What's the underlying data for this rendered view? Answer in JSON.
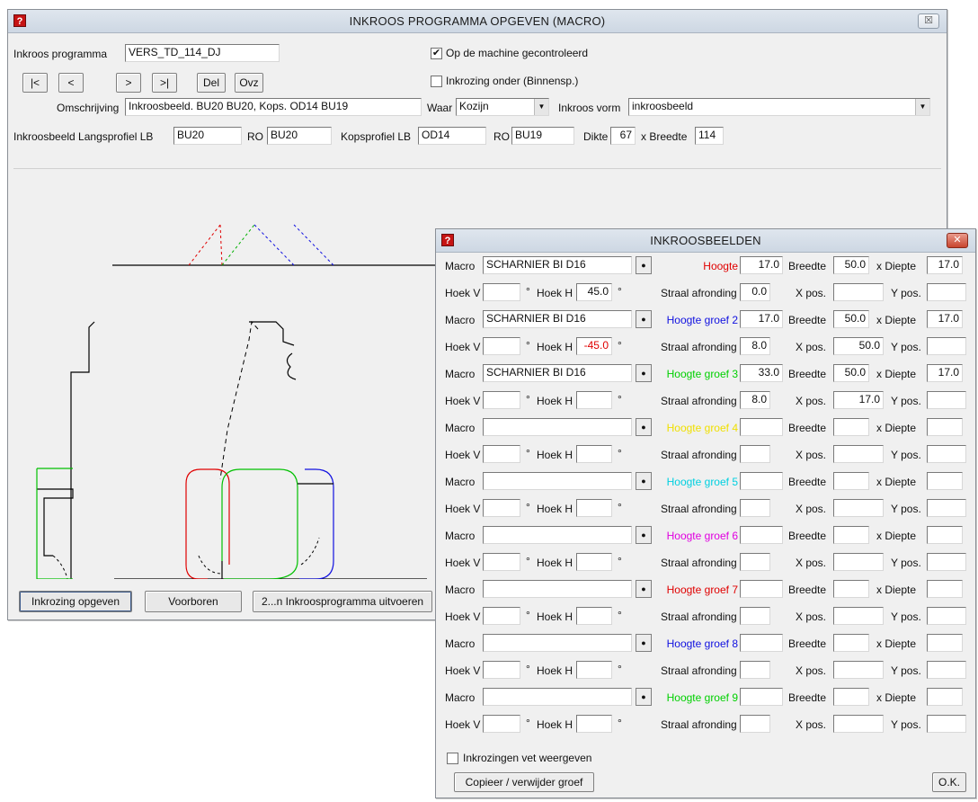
{
  "main_window": {
    "title": "INKROOS PROGRAMMA OPGEVEN (MACRO)",
    "close_glyph": "☒",
    "program_label": "Inkroos programma",
    "program_value": "VERS_TD_114_DJ",
    "nav": {
      "first": "|<",
      "prev": "<",
      "next": ">",
      "last": ">|",
      "del": "Del",
      "ovz": "Ovz"
    },
    "checked_on_machine": {
      "label": "Op de machine gecontroleerd",
      "checked": true,
      "glyph": "✔"
    },
    "inkrozing_onder": {
      "label": "Inkrozing onder (Binnensp.)",
      "checked": false
    },
    "omschrijving_label": "Omschrijving",
    "omschrijving_value": "Inkroosbeeld. BU20 BU20, Kops. OD14 BU19",
    "waar_label": "Waar",
    "waar_value": "Kozijn",
    "vorm_label": "Inkroos vorm",
    "vorm_value": "inkroosbeeld",
    "langsprofiel_label": "Inkroosbeeld Langsprofiel LB",
    "langsprofiel_lb": "BU20",
    "ro_label": "RO",
    "langsprofiel_ro": "BU20",
    "kopsprofiel_label": "Kopsprofiel LB",
    "kopsprofiel_lb": "OD14",
    "kopsprofiel_ro": "BU19",
    "dikte_label": "Dikte",
    "dikte_value": "67",
    "breedte_label": "x Breedte",
    "breedte_value": "114",
    "buttons": {
      "inkrozing": "Inkrozing opgeven",
      "voorboren": "Voorboren",
      "uitvoeren": "2...n Inkroosprogramma uitvoeren"
    }
  },
  "dialog": {
    "title": "INKROOSBEELDEN",
    "close_glyph": "✕",
    "labels": {
      "macro": "Macro",
      "hoek_v": "Hoek V",
      "deg": "°",
      "hoek_h": "Hoek H",
      "straal": "Straal afronding",
      "breedte": "Breedte",
      "diepte": "x Diepte",
      "xpos": "X pos.",
      "ypos": "Y pos."
    },
    "rows": [
      {
        "macro": "SCHARNIER BI D16",
        "hoogte_label": "Hoogte",
        "color": "#e00000",
        "hoogte": "17.0",
        "breedte": "50.0",
        "diepte": "17.0",
        "hoek_v": "",
        "hoek_h": "45.0",
        "straal": "0.0",
        "xpos": "",
        "ypos": ""
      },
      {
        "macro": "SCHARNIER BI D16",
        "hoogte_label": "Hoogte groef 2",
        "color": "#1010e0",
        "hoogte": "17.0",
        "breedte": "50.0",
        "diepte": "17.0",
        "hoek_v": "",
        "hoek_h": "-45.0",
        "straal": "8.0",
        "xpos": "50.0",
        "ypos": ""
      },
      {
        "macro": "SCHARNIER BI D16",
        "hoogte_label": "Hoogte groef 3",
        "color": "#00d000",
        "hoogte": "33.0",
        "breedte": "50.0",
        "diepte": "17.0",
        "hoek_v": "",
        "hoek_h": "",
        "straal": "8.0",
        "xpos": "17.0",
        "ypos": ""
      },
      {
        "macro": "",
        "hoogte_label": "Hoogte groef 4",
        "color": "#f0e000",
        "hoogte": "",
        "breedte": "",
        "diepte": "",
        "hoek_v": "",
        "hoek_h": "",
        "straal": "",
        "xpos": "",
        "ypos": ""
      },
      {
        "macro": "",
        "hoogte_label": "Hoogte groef 5",
        "color": "#00d0e0",
        "hoogte": "",
        "breedte": "",
        "diepte": "",
        "hoek_v": "",
        "hoek_h": "",
        "straal": "",
        "xpos": "",
        "ypos": ""
      },
      {
        "macro": "",
        "hoogte_label": "Hoogte groef 6",
        "color": "#e000e0",
        "hoogte": "",
        "breedte": "",
        "diepte": "",
        "hoek_v": "",
        "hoek_h": "",
        "straal": "",
        "xpos": "",
        "ypos": ""
      },
      {
        "macro": "",
        "hoogte_label": "Hoogte groef 7",
        "color": "#e00000",
        "hoogte": "",
        "breedte": "",
        "diepte": "",
        "hoek_v": "",
        "hoek_h": "",
        "straal": "",
        "xpos": "",
        "ypos": ""
      },
      {
        "macro": "",
        "hoogte_label": "Hoogte groef 8",
        "color": "#1010e0",
        "hoogte": "",
        "breedte": "",
        "diepte": "",
        "hoek_v": "",
        "hoek_h": "",
        "straal": "",
        "xpos": "",
        "ypos": ""
      },
      {
        "macro": "",
        "hoogte_label": "Hoogte groef 9",
        "color": "#00d000",
        "hoogte": "",
        "breedte": "",
        "diepte": "",
        "hoek_v": "",
        "hoek_h": "",
        "straal": "",
        "xpos": "",
        "ypos": ""
      }
    ],
    "vet_checkbox_label": "Inkrozingen vet weergeven",
    "copy_button": "Copieer / verwijder groef",
    "ok_button": "O.K."
  }
}
